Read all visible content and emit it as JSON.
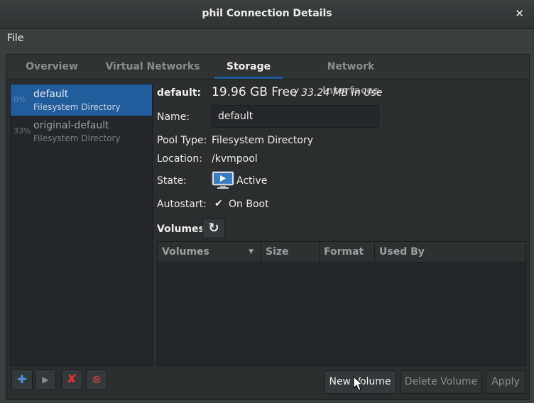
{
  "window": {
    "title": "phil Connection Details"
  },
  "menu": {
    "file": "File"
  },
  "tabs": [
    "Overview",
    "Virtual Networks",
    "Storage",
    "Network Interfaces"
  ],
  "pools": [
    {
      "percent": "0%",
      "name": "default",
      "type": "Filesystem Directory",
      "selected": true
    },
    {
      "percent": "33%",
      "name": "original-default",
      "type": "Filesystem Directory",
      "selected": false
    }
  ],
  "details": {
    "pool_label": "default:",
    "free": "19.96 GB Free",
    "in_use": "/ 33.24 MB In Use",
    "name_label": "Name:",
    "name_value": "default",
    "pool_type_label": "Pool Type:",
    "pool_type_value": "Filesystem Directory",
    "location_label": "Location:",
    "location_value": "/kvmpool",
    "state_label": "State:",
    "state_value": "Active",
    "autostart_label": "Autostart:",
    "autostart_value": "On Boot",
    "volumes_label": "Volumes"
  },
  "volume_table": {
    "columns": [
      "Volumes",
      "Size",
      "Format",
      "Used By"
    ]
  },
  "buttons": {
    "new_volume": "New Volume",
    "delete_volume": "Delete Volume",
    "apply": "Apply"
  },
  "colors": {
    "accent": "#215d9c",
    "background": "#393f3f"
  }
}
